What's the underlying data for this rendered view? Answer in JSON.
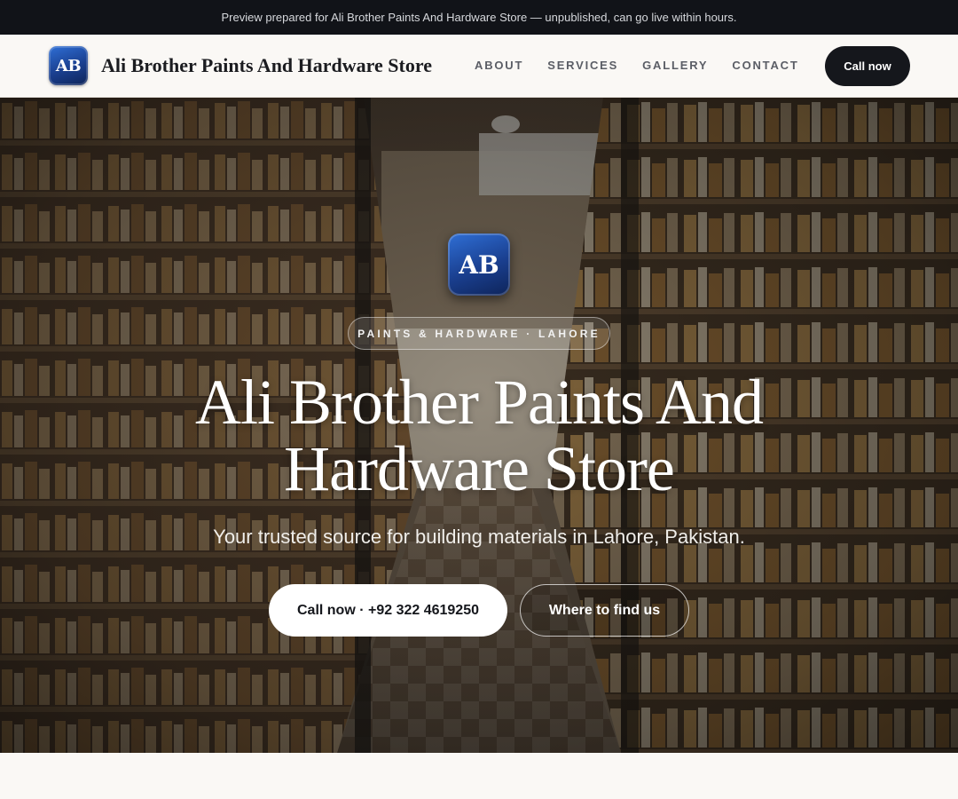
{
  "banner": {
    "text": "Preview prepared for Ali Brother Paints And Hardware Store — unpublished, can go live within hours."
  },
  "header": {
    "logo_initials": "AB",
    "brand_name": "Ali Brother Paints And Hardware Store",
    "nav": [
      {
        "label": "ABOUT"
      },
      {
        "label": "SERVICES"
      },
      {
        "label": "GALLERY"
      },
      {
        "label": "CONTACT"
      }
    ],
    "cta_label": "Call now"
  },
  "hero": {
    "logo_initials": "AB",
    "tagline": "PAINTS & HARDWARE · LAHORE",
    "title": "Ali Brother Paints And Hardware Store",
    "subtitle": "Your trusted source for building materials in Lahore, Pakistan.",
    "primary_button": "Call now · +92 322 4619250",
    "secondary_button": "Where to find us",
    "background_image": "store-aisle-shelves"
  },
  "colors": {
    "banner_bg": "#111318",
    "header_bg": "#faf8f5",
    "brand_blue": "#1a3f8f",
    "dark_button": "#15171c",
    "white": "#ffffff"
  }
}
